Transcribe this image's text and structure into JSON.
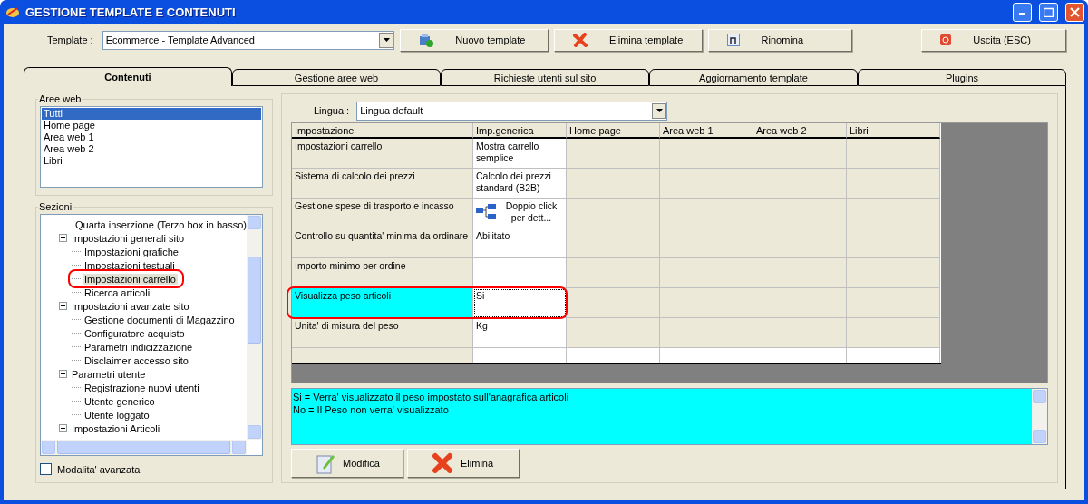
{
  "window": {
    "title": "GESTIONE TEMPLATE E CONTENUTI"
  },
  "toolbar": {
    "template_label": "Template :",
    "template_value": "Ecommerce - Template Advanced",
    "buttons": [
      {
        "label": "Nuovo template",
        "kind": "new"
      },
      {
        "label": "Elimina template",
        "kind": "delete"
      },
      {
        "label": "Rinomina",
        "kind": "rename"
      },
      {
        "label": "Uscita (ESC)",
        "kind": "exit"
      }
    ]
  },
  "tabs": [
    {
      "label": "Contenuti",
      "selected": true
    },
    {
      "label": "Gestione aree web",
      "selected": false
    },
    {
      "label": "Richieste utenti sul sito",
      "selected": false
    },
    {
      "label": "Aggiornamento template",
      "selected": false
    },
    {
      "label": "Plugins",
      "selected": false
    }
  ],
  "aree_web": {
    "title": "Aree web",
    "items": [
      {
        "label": "Tutti",
        "selected": true
      },
      {
        "label": "Home page",
        "selected": false
      },
      {
        "label": "Area web 1",
        "selected": false
      },
      {
        "label": "Area web 2",
        "selected": false
      },
      {
        "label": "Libri",
        "selected": false
      }
    ]
  },
  "sezioni": {
    "title": "Sezioni",
    "scrolled_children": [
      {
        "label": "Quarta inserzione (Terzo box in basso)",
        "selected": false
      }
    ],
    "items": [
      {
        "label": "Impostazioni generali sito",
        "expanded": true,
        "selected": false,
        "children": [
          {
            "label": "Impostazioni grafiche",
            "selected": false
          },
          {
            "label": "Impostazioni testuali",
            "selected": false
          },
          {
            "label": "Impostazioni carrello",
            "selected": true,
            "marked": true
          },
          {
            "label": "Ricerca articoli",
            "selected": false
          }
        ]
      },
      {
        "label": "Impostazioni avanzate sito",
        "expanded": true,
        "selected": false,
        "children": [
          {
            "label": "Gestione documenti di Magazzino",
            "selected": false
          },
          {
            "label": "Configuratore acquisto",
            "selected": false
          },
          {
            "label": "Parametri indicizzazione",
            "selected": false
          },
          {
            "label": "Disclaimer accesso sito",
            "selected": false
          }
        ]
      },
      {
        "label": "Parametri utente",
        "expanded": true,
        "selected": false,
        "children": [
          {
            "label": "Registrazione nuovi utenti",
            "selected": false
          },
          {
            "label": "Utente generico",
            "selected": false
          },
          {
            "label": "Utente loggato",
            "selected": false
          }
        ]
      },
      {
        "label": "Impostazioni Articoli",
        "expanded": true,
        "selected": false
      }
    ],
    "advanced_checkbox": {
      "label": "Modalita' avanzata",
      "checked": false
    }
  },
  "lingua": {
    "label": "Lingua :",
    "value": "Lingua default"
  },
  "table": {
    "columns": [
      "Impostazione",
      "Imp.generica",
      "Home page",
      "Area web 1",
      "Area web 2",
      "Libri"
    ],
    "rows": [
      {
        "name": "Impostazioni carrello",
        "value": "Mostra carrello semplice",
        "kind": "text",
        "selected": false,
        "marked": false
      },
      {
        "name": "Sistema di calcolo dei prezzi",
        "value": "Calcolo dei prezzi standard (B2B)",
        "kind": "text",
        "selected": false,
        "marked": false
      },
      {
        "name": "Gestione spese di trasporto e incasso",
        "value": "Doppio click per dett...",
        "kind": "detail",
        "selected": false,
        "marked": false
      },
      {
        "name": "Controllo su quantita' minima da ordinare",
        "value": "Abilitato",
        "kind": "text",
        "selected": false,
        "marked": false
      },
      {
        "name": "Importo minimo per ordine",
        "kind": "text",
        "selected": false,
        "marked": false
      },
      {
        "name": "Visualizza peso articoli",
        "value": "Si",
        "kind": "text",
        "selected": true,
        "marked": true
      },
      {
        "name": "Unita' di misura del peso",
        "value": "Kg",
        "kind": "text",
        "selected": false,
        "marked": false
      }
    ]
  },
  "description": [
    "Si = Verra' visualizzato il peso impostato sull'anagrafica articoli",
    "No = Il Peso non verra' visualizzato"
  ],
  "actions": [
    {
      "label": "Modifica",
      "kind": "edit"
    },
    {
      "label": "Elimina",
      "kind": "delete"
    }
  ]
}
